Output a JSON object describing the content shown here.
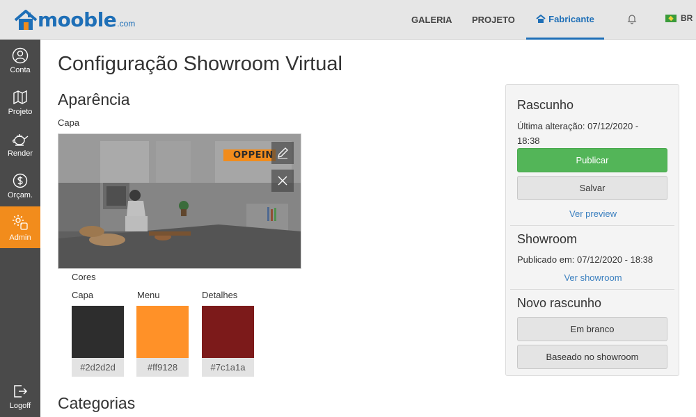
{
  "brand": {
    "name": "mooble",
    "suffix": ".com",
    "color": "#1e6fb7"
  },
  "nav": {
    "galeria": "GALERIA",
    "projeto": "PROJETO",
    "fabricante": "Fabricante",
    "lang": "BR"
  },
  "sidebar": {
    "items": [
      {
        "label": "Conta",
        "icon": "user-icon"
      },
      {
        "label": "Projeto",
        "icon": "blueprint-icon"
      },
      {
        "label": "Render",
        "icon": "teapot-icon"
      },
      {
        "label": "Orçam.",
        "icon": "dollar-icon"
      },
      {
        "label": "Admin",
        "icon": "gear-icon"
      }
    ],
    "logoff": "Logoff",
    "active_color": "#f28c1c"
  },
  "main": {
    "title": "Configuração Showroom Virtual",
    "appearance": "Aparência",
    "cover_label": "Capa",
    "cover_brand": "OPPEIN",
    "colors_label": "Cores",
    "swatches": [
      {
        "label": "Capa",
        "hex": "#2d2d2d",
        "hex_text": "#2d2d2d"
      },
      {
        "label": "Menu",
        "hex": "#ff9128",
        "hex_text": "#ff9128"
      },
      {
        "label": "Detalhes",
        "hex": "#7c1a1a",
        "hex_text": "#7c1a1a"
      }
    ],
    "categories": "Categorias"
  },
  "panel": {
    "draft_title": "Rascunho",
    "last_change_1": "Última alteração: 07/12/2020 -",
    "last_change_2": "18:38",
    "publish": "Publicar",
    "save": "Salvar",
    "preview": "Ver preview",
    "showroom_title": "Showroom",
    "published": "Publicado em: 07/12/2020 - 18:38",
    "view_showroom": "Ver showroom",
    "new_draft_title": "Novo rascunho",
    "blank": "Em branco",
    "based": "Baseado no showroom"
  }
}
